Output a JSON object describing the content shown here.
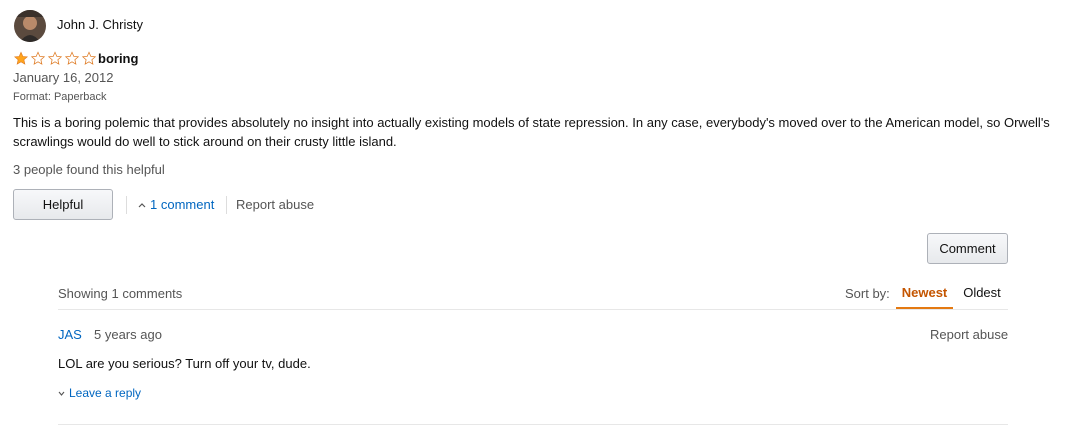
{
  "review": {
    "reviewer_name": "John J. Christy",
    "rating": 1,
    "max_rating": 5,
    "title": "boring",
    "date": "January 16, 2012",
    "format": "Format: Paperback",
    "body": "This is a boring polemic that provides absolutely no insight into actually existing models of state repression. In any case, everybody's moved over to the American model, so Orwell's scrawlings would do well to stick around on their crusty little island.",
    "helpful_count_text": "3 people found this helpful",
    "helpful_button": "Helpful",
    "comments_toggle": "1 comment",
    "report_abuse": "Report abuse"
  },
  "comments_section": {
    "comment_button": "Comment",
    "showing_text": "Showing 1 comments",
    "sort_label": "Sort by:",
    "sort_options": [
      "Newest",
      "Oldest"
    ],
    "sort_selected": "Newest",
    "items": [
      {
        "author": "JAS",
        "time": "5 years ago",
        "report": "Report abuse",
        "body": "LOL are you serious? Turn off your tv, dude.",
        "reply_label": "Leave a reply"
      }
    ]
  },
  "colors": {
    "link": "#0066c0",
    "star": "#ffa41c",
    "sort_active": "#c45500"
  },
  "icons": {
    "avatar": "avatar-image",
    "star_filled": "star-filled-icon",
    "star_empty": "star-empty-icon",
    "toggle": "chevron-up-icon",
    "reply": "chevron-down-icon"
  }
}
